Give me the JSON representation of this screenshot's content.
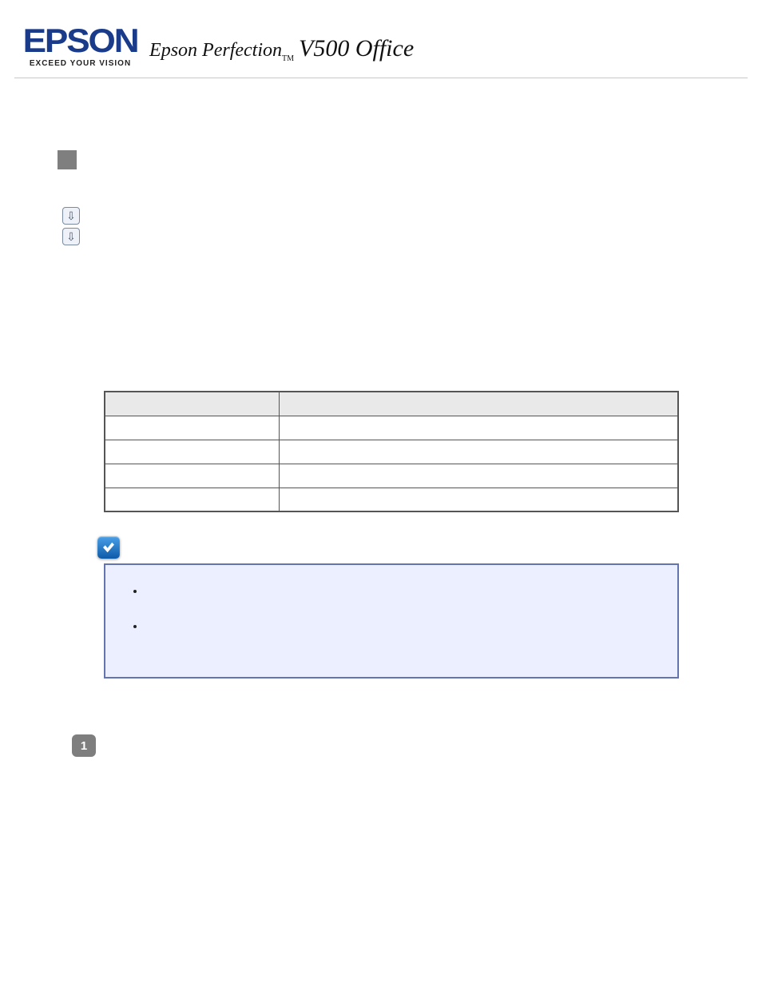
{
  "header": {
    "brand": "EPSON",
    "tagline": "EXCEED YOUR VISION",
    "product_line": "Epson Perfection",
    "tm": "TM",
    "model": "V500 Office"
  },
  "section_marker": "",
  "anchors": [
    {
      "icon": "down-arrow",
      "label": ""
    },
    {
      "icon": "down-arrow",
      "label": ""
    }
  ],
  "spec_table": {
    "headers": [
      "",
      ""
    ],
    "rows": [
      [
        "",
        ""
      ],
      [
        "",
        ""
      ],
      [
        "",
        ""
      ],
      [
        "",
        ""
      ]
    ]
  },
  "note": {
    "items": [
      "",
      ""
    ]
  },
  "step1": "1"
}
